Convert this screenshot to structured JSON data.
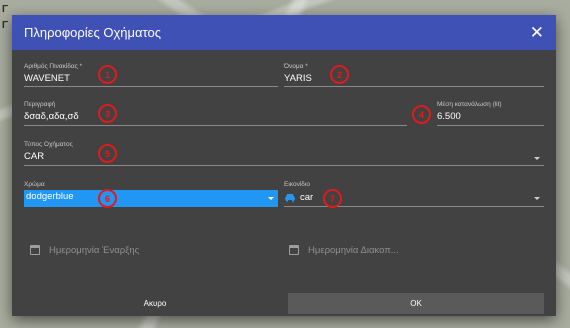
{
  "dialog": {
    "title": "Πληροφορίες Οχήματος",
    "close_icon": "close-icon"
  },
  "fields": {
    "plate": {
      "label": "Αριθμός Πινακίδας *",
      "value": "WAVENET",
      "badge": "1"
    },
    "name": {
      "label": "Όνομα *",
      "value": "YARIS",
      "badge": "2"
    },
    "description": {
      "label": "Περιγραφή",
      "value": "δσαδ,αδα,σδ",
      "badge": "3"
    },
    "consumption": {
      "label": "Μέση κατανάλωση (lit)",
      "value": "6.500",
      "badge": "4"
    },
    "vehicle_type": {
      "label": "Τύπος Οχήματος",
      "value": "CAR",
      "badge": "5"
    },
    "color": {
      "label": "Χρώμα",
      "value": "dodgerblue",
      "badge": "6",
      "accent": "#2196f3"
    },
    "icon": {
      "label": "Εικονίδιο",
      "value": "car",
      "icon_name": "car-icon",
      "badge": "7"
    }
  },
  "dates": {
    "start_placeholder": "Ημερομηνία Έναρξης",
    "end_placeholder": "Ημερομηνία Διακοπ...",
    "icon_name": "calendar-icon"
  },
  "buttons": {
    "cancel_label": "Ακυρο",
    "ok_label": "OK"
  },
  "colors": {
    "header": "#3f51b5",
    "dialog_bg": "#424242",
    "badge": "#e01b1b",
    "ok_bg": "#5a5a5a"
  }
}
